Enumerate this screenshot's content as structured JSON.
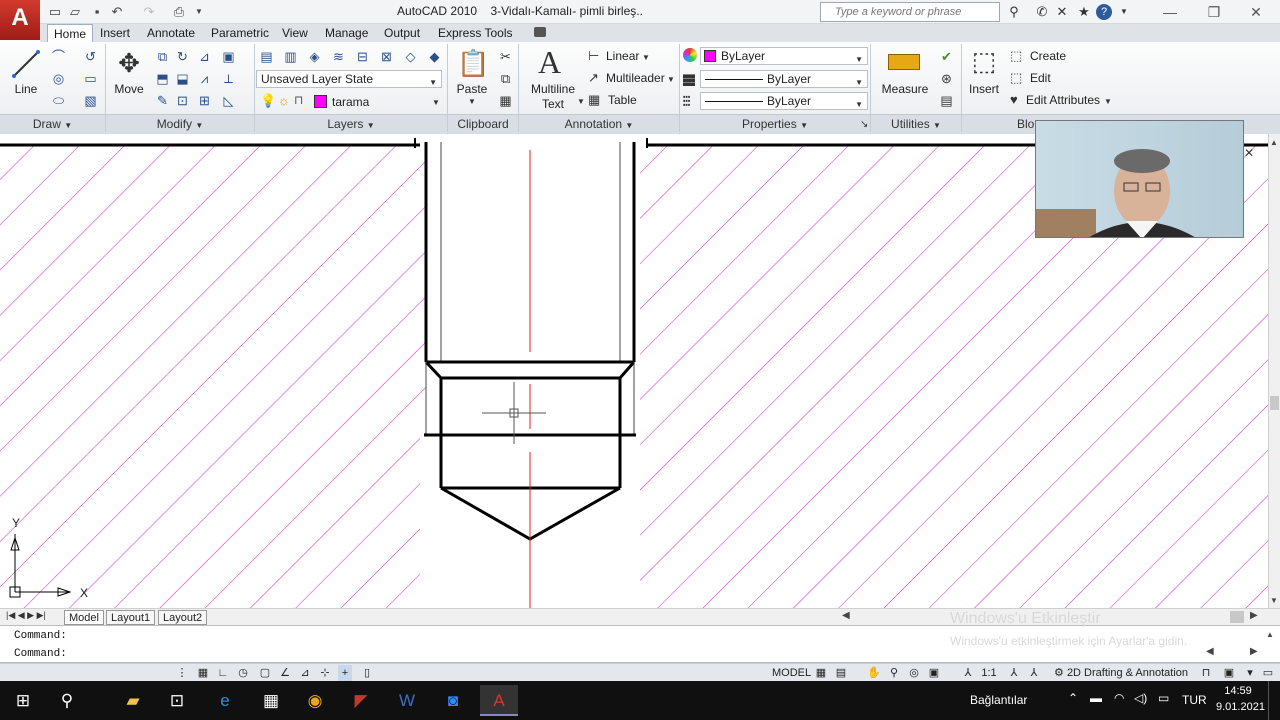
{
  "titlebar": {
    "app": "AutoCAD 2010",
    "document": "3-Vidalı-Kamalı- pimli birleş..",
    "search_placeholder": "Type a keyword or phrase",
    "logo": "A"
  },
  "tabs": [
    "Home",
    "Insert",
    "Annotate",
    "Parametric",
    "View",
    "Manage",
    "Output",
    "Express Tools"
  ],
  "ribbon": {
    "draw": {
      "panel": "Draw",
      "line": "Line"
    },
    "modify": {
      "panel": "Modify",
      "move": "Move"
    },
    "layers": {
      "panel": "Layers",
      "layer_state": "Unsaved Layer State",
      "current_layer": "tarama",
      "layer_color": "#ff00ff"
    },
    "clipboard": {
      "panel": "Clipboard",
      "paste": "Paste"
    },
    "annotation": {
      "panel": "Annotation",
      "mtext_line1": "Multiline",
      "mtext_line2": "Text",
      "linear": "Linear",
      "multileader": "Multileader",
      "table": "Table"
    },
    "properties": {
      "panel": "Properties",
      "color": "ByLayer",
      "linetype": "ByLayer",
      "lineweight": "ByLayer"
    },
    "utilities": {
      "panel": "Utilities",
      "measure": "Measure"
    },
    "block": {
      "panel": "Blo",
      "insert": "Insert",
      "create": "Create",
      "edit": "Edit",
      "edit_attributes": "Edit Attributes"
    }
  },
  "canvas": {
    "ucs_x": "X",
    "ucs_y": "Y",
    "hatch_color": "#cc22cc",
    "center_color": "#e02020"
  },
  "layout_tabs": [
    "Model",
    "Layout1",
    "Layout2"
  ],
  "command": {
    "line1": "Command:",
    "line2": "Command:"
  },
  "status": {
    "model": "MODEL",
    "scale": "1:1",
    "workspace": "2D Drafting & Annotation"
  },
  "watermark": {
    "line1": "Windows'u Etkinleştir",
    "line2": "Windows'u etkinleştirmek için Ayarlar'a gidin."
  },
  "taskbar": {
    "connections": "Bağlantılar",
    "language": "TUR",
    "time": "14:59",
    "date": "9.01.2021"
  }
}
